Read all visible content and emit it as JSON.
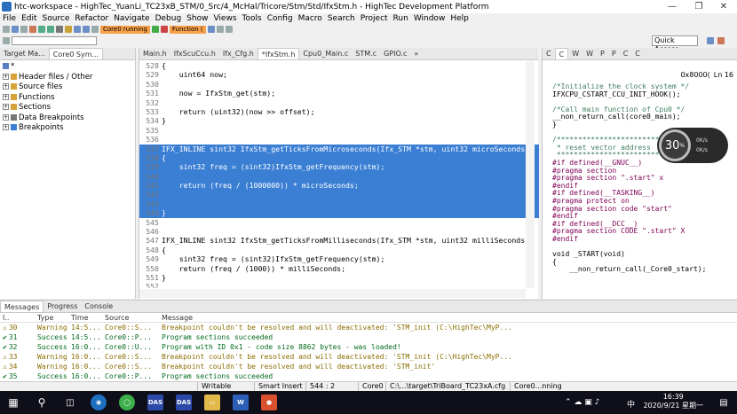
{
  "window": {
    "title": "htc-workspace - HighTec_YuanLi_TC23xB_STM/0_Src/4_McHal/Tricore/Stm/Std/IfxStm.h - HighTec Development Platform"
  },
  "menu": [
    "File",
    "Edit",
    "Source",
    "Refactor",
    "Navigate",
    "Debug",
    "Show",
    "Views",
    "Tools",
    "Config",
    "Macro",
    "Search",
    "Project",
    "Run",
    "Window",
    "Help"
  ],
  "toolbar": {
    "core_label": "Core0 running",
    "function_label": "Function ("
  },
  "quick_access": "Quick Access",
  "left_panel": {
    "tabs": [
      "Target Ma...",
      "Core0 Sym..."
    ],
    "tree": [
      {
        "label": "*",
        "kind": "root"
      },
      {
        "label": "Header files / Other",
        "kind": "folder"
      },
      {
        "label": "Source files",
        "kind": "folder"
      },
      {
        "label": "Functions",
        "kind": "folder"
      },
      {
        "label": "Sections",
        "kind": "folder"
      },
      {
        "label": "Data Breakpoints",
        "kind": "item"
      },
      {
        "label": "Breakpoints",
        "kind": "item"
      }
    ]
  },
  "editor": {
    "tabs": [
      "Main.h",
      "IfxScuCcu.h",
      "Ifx_Cfg.h",
      "*IfxStm.h",
      "Cpu0_Main.c",
      "STM.c",
      "GPIO.c",
      "»"
    ],
    "active_tab": 3,
    "lines": [
      {
        "n": "528",
        "t": "{",
        "sel": false
      },
      {
        "n": "529",
        "t": "    uint64 now;",
        "sel": false
      },
      {
        "n": "530",
        "t": "",
        "sel": false
      },
      {
        "n": "531",
        "t": "    now = IfxStm_get(stm);",
        "sel": false
      },
      {
        "n": "532",
        "t": "",
        "sel": false
      },
      {
        "n": "533",
        "t": "    return (uint32)(now >> offset);",
        "sel": false
      },
      {
        "n": "534",
        "t": "}",
        "sel": false
      },
      {
        "n": "535",
        "t": "",
        "sel": false
      },
      {
        "n": "536",
        "t": "",
        "sel": false
      },
      {
        "n": "537",
        "t": "IFX_INLINE sint32 IfxStm_getTicksFromMicroseconds(Ifx_STM *stm, uint32 microSeconds)",
        "sel": true
      },
      {
        "n": "538",
        "t": "{",
        "sel": true
      },
      {
        "n": "539",
        "t": "    sint32 freq = (sint32)IfxStm_getFrequency(stm);",
        "sel": true
      },
      {
        "n": "540",
        "t": "",
        "sel": true
      },
      {
        "n": "541",
        "t": "    return (freq / (1000000)) * microSeconds;",
        "sel": true
      },
      {
        "n": "542",
        "t": "",
        "sel": true
      },
      {
        "n": "543",
        "t": "",
        "sel": true
      },
      {
        "n": "544",
        "t": "}",
        "sel": true
      },
      {
        "n": "545",
        "t": "",
        "sel": false
      },
      {
        "n": "546",
        "t": "",
        "sel": false
      },
      {
        "n": "547",
        "t": "IFX_INLINE sint32 IfxStm_getTicksFromMilliseconds(Ifx_STM *stm, uint32 milliSeconds)",
        "sel": false
      },
      {
        "n": "548",
        "t": "{",
        "sel": false
      },
      {
        "n": "549",
        "t": "    sint32 freq = (sint32)IfxStm_getFrequency(stm);",
        "sel": false
      },
      {
        "n": "550",
        "t": "    return (freq / (1000)) * milliSeconds;",
        "sel": false
      },
      {
        "n": "551",
        "t": "}",
        "sel": false
      },
      {
        "n": "552",
        "t": "",
        "sel": false
      }
    ]
  },
  "right_panel": {
    "tabs": [
      "C",
      "C",
      "W",
      "W",
      "P",
      "P",
      "C",
      "C"
    ],
    "address": "0x8000(",
    "ln": "Ln 16",
    "lines": [
      {
        "t": "/*Initialize the clock system */",
        "k": "c"
      },
      {
        "t": "IFXCPU_CSTART_CCU_INIT_HOOK();",
        "k": "n"
      },
      {
        "t": "",
        "k": "n"
      },
      {
        "t": "/*Call main function of Cpu0 */",
        "k": "c"
      },
      {
        "t": "__non_return_call(core0_main);",
        "k": "n"
      },
      {
        "t": "}",
        "k": "n"
      },
      {
        "t": "",
        "k": "n"
      },
      {
        "t": "/***************************************",
        "k": "c"
      },
      {
        "t": " * reset vector address",
        "k": "c"
      },
      {
        "t": " ***************************************",
        "k": "c"
      },
      {
        "t": "#if defined(__GNUC__)",
        "k": "pp"
      },
      {
        "t": "#pragma section",
        "k": "pp"
      },
      {
        "t": "#pragma section \".start\" x",
        "k": "pp"
      },
      {
        "t": "#endif",
        "k": "pp"
      },
      {
        "t": "#if defined(__TASKING__)",
        "k": "pp"
      },
      {
        "t": "#pragma protect on",
        "k": "pp"
      },
      {
        "t": "#pragma section code \"start\"",
        "k": "pp"
      },
      {
        "t": "#endif",
        "k": "pp"
      },
      {
        "t": "#if defined(__DCC__)",
        "k": "pp"
      },
      {
        "t": "#pragma section CODE \".start\" X",
        "k": "pp"
      },
      {
        "t": "#endif",
        "k": "pp"
      },
      {
        "t": "",
        "k": "n"
      },
      {
        "t": "void _START(void)",
        "k": "n"
      },
      {
        "t": "{",
        "k": "n"
      },
      {
        "t": "    __non_return_call(_Core0_start);",
        "k": "n"
      }
    ]
  },
  "perf_widget": {
    "value": "30",
    "unit": "%",
    "up": "0K/s",
    "down": "0K/s"
  },
  "messages": {
    "tabs": [
      "Messages",
      "Progress",
      "Console"
    ],
    "headers": [
      "I..",
      "Type",
      "Time",
      "Source",
      "Message"
    ],
    "rows": [
      {
        "id": "30",
        "type": "Warning",
        "time": "14:5...",
        "source": "Core0::S...",
        "message": "Breakpoint couldn't be resolved and will deactivated: 'STM_init (C:\\HighTec\\MyP...",
        "level": "warn"
      },
      {
        "id": "31",
        "type": "Success",
        "time": "14:5...",
        "source": "Core0::P...",
        "message": "Program sections succeeded",
        "level": "success"
      },
      {
        "id": "32",
        "type": "Success",
        "time": "16:0...",
        "source": "Core0::U...",
        "message": "Program with ID 0x1 - code size 8862 bytes - was loaded!",
        "level": "success"
      },
      {
        "id": "33",
        "type": "Warning",
        "time": "16:0...",
        "source": "Core0::S...",
        "message": "Breakpoint couldn't be resolved and will deactivated: 'STM_init (C:\\HighTec\\MyP...",
        "level": "warn"
      },
      {
        "id": "34",
        "type": "Warning",
        "time": "16:0...",
        "source": "Core0::S...",
        "message": "Breakpoint couldn't be resolved and will deactivated: 'STM_init'",
        "level": "warn"
      },
      {
        "id": "35",
        "type": "Success",
        "time": "16:0...",
        "source": "Core0::P...",
        "message": "Program sections succeeded",
        "level": "success"
      }
    ]
  },
  "status": {
    "mode": "Writable",
    "insert": "Smart Insert",
    "pos": "544 : 2",
    "core": "Core0",
    "path": "C:\\...\\target\\TriBoard_TC23xA.cfg",
    "state": "Core0...nning"
  },
  "taskbar": {
    "time": "16:39",
    "date": "2020/9/21 星期一",
    "ime": "中"
  }
}
